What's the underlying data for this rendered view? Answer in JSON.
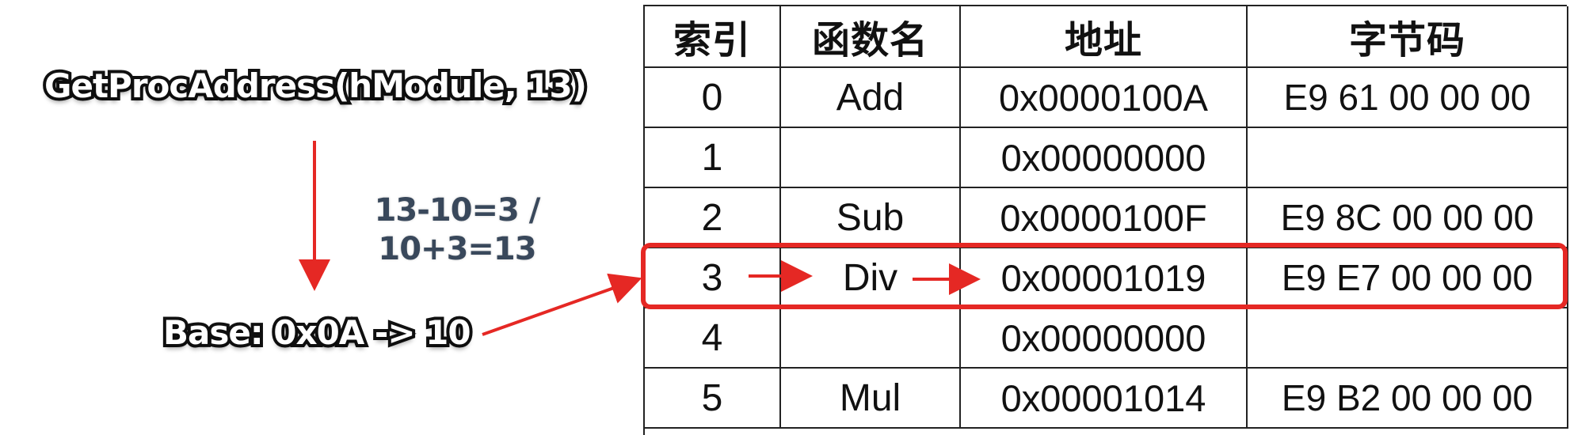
{
  "labels": {
    "call": "GetProcAddress(hModule, 13)",
    "calc": "13-10=3 / 10+3=13",
    "base": "Base: 0x0A -> 10"
  },
  "table": {
    "headers": [
      "索引",
      "函数名",
      "地址",
      "字节码"
    ],
    "rows": [
      [
        "0",
        "Add",
        "0x0000100A",
        "E9 61 00 00 00"
      ],
      [
        "1",
        "",
        "0x00000000",
        ""
      ],
      [
        "2",
        "Sub",
        "0x0000100F",
        "E9 8C 00 00 00"
      ],
      [
        "3",
        "Div",
        "0x00001019",
        "E9 E7 00 00 00"
      ],
      [
        "4",
        "",
        "0x00000000",
        ""
      ],
      [
        "5",
        "Mul",
        "0x00001014",
        "E9 B2 00 00 00"
      ]
    ]
  },
  "colors": {
    "accent": "#e52824",
    "text": "#111111",
    "calc": "#39485b"
  }
}
